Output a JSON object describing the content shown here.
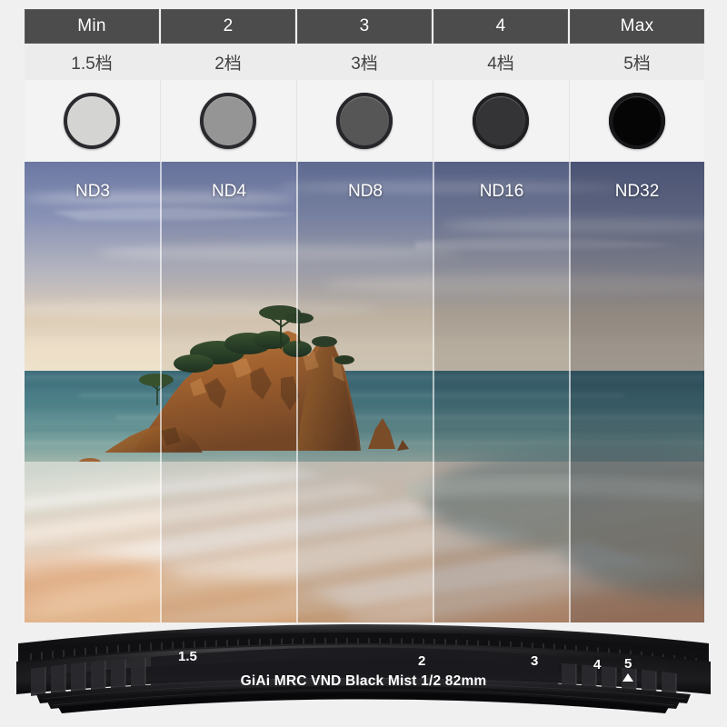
{
  "product": {
    "brand": "GiAi",
    "ring_text": "GiAi   MRC   VND   Black   Mist 1/2   82mm",
    "coating": "MRC",
    "type": "VND",
    "effect": "Black Mist 1/2",
    "thread_size": "82mm"
  },
  "header": {
    "cells": [
      {
        "label": "Min"
      },
      {
        "label": "2"
      },
      {
        "label": "3"
      },
      {
        "label": "4"
      },
      {
        "label": "Max"
      }
    ]
  },
  "stops": {
    "cells": [
      {
        "label": "1.5档"
      },
      {
        "label": "2档"
      },
      {
        "label": "3档"
      },
      {
        "label": "4档"
      },
      {
        "label": "5档"
      }
    ]
  },
  "glass_samples": [
    {
      "name": "Min",
      "fill": "#d4d4d2",
      "ring": "#2a2a2e"
    },
    {
      "name": "2",
      "fill": "#959595",
      "ring": "#2a2a2e"
    },
    {
      "name": "3",
      "fill": "#565656",
      "ring": "#26262a"
    },
    {
      "name": "4",
      "fill": "#343436",
      "ring": "#1f1f22"
    },
    {
      "name": "Max",
      "fill": "#050506",
      "ring": "#18181b"
    }
  ],
  "nd_panels": [
    {
      "label": "ND3",
      "darkness": 0.0
    },
    {
      "label": "ND4",
      "darkness": 0.07
    },
    {
      "label": "ND8",
      "darkness": 0.15
    },
    {
      "label": "ND16",
      "darkness": 0.25
    },
    {
      "label": "ND32",
      "darkness": 0.36
    }
  ],
  "ring_scale": {
    "marks": [
      "1.5",
      "2",
      "3",
      "4",
      "5"
    ],
    "indicator": "▲",
    "indicator_at": "5"
  },
  "colors": {
    "header_bg": "#4c4c4d",
    "header_text": "#ffffff",
    "stop_bg": "#ececec",
    "stop_text": "#414141",
    "page_bg": "#f0f0f0",
    "panel_bg": "#f3f3f3",
    "ring_body": "#17171a",
    "ring_text": "#ffffff",
    "divider": "rgba(255,255,255,0.62)"
  },
  "photo": {
    "subject": "long-exposure seascape with rocky tree-topped island",
    "sky_top": "#6f7ba4",
    "sky_horizon": "#e9ddc9",
    "sea": "#4d8189",
    "sand": "#e6c4a8"
  }
}
